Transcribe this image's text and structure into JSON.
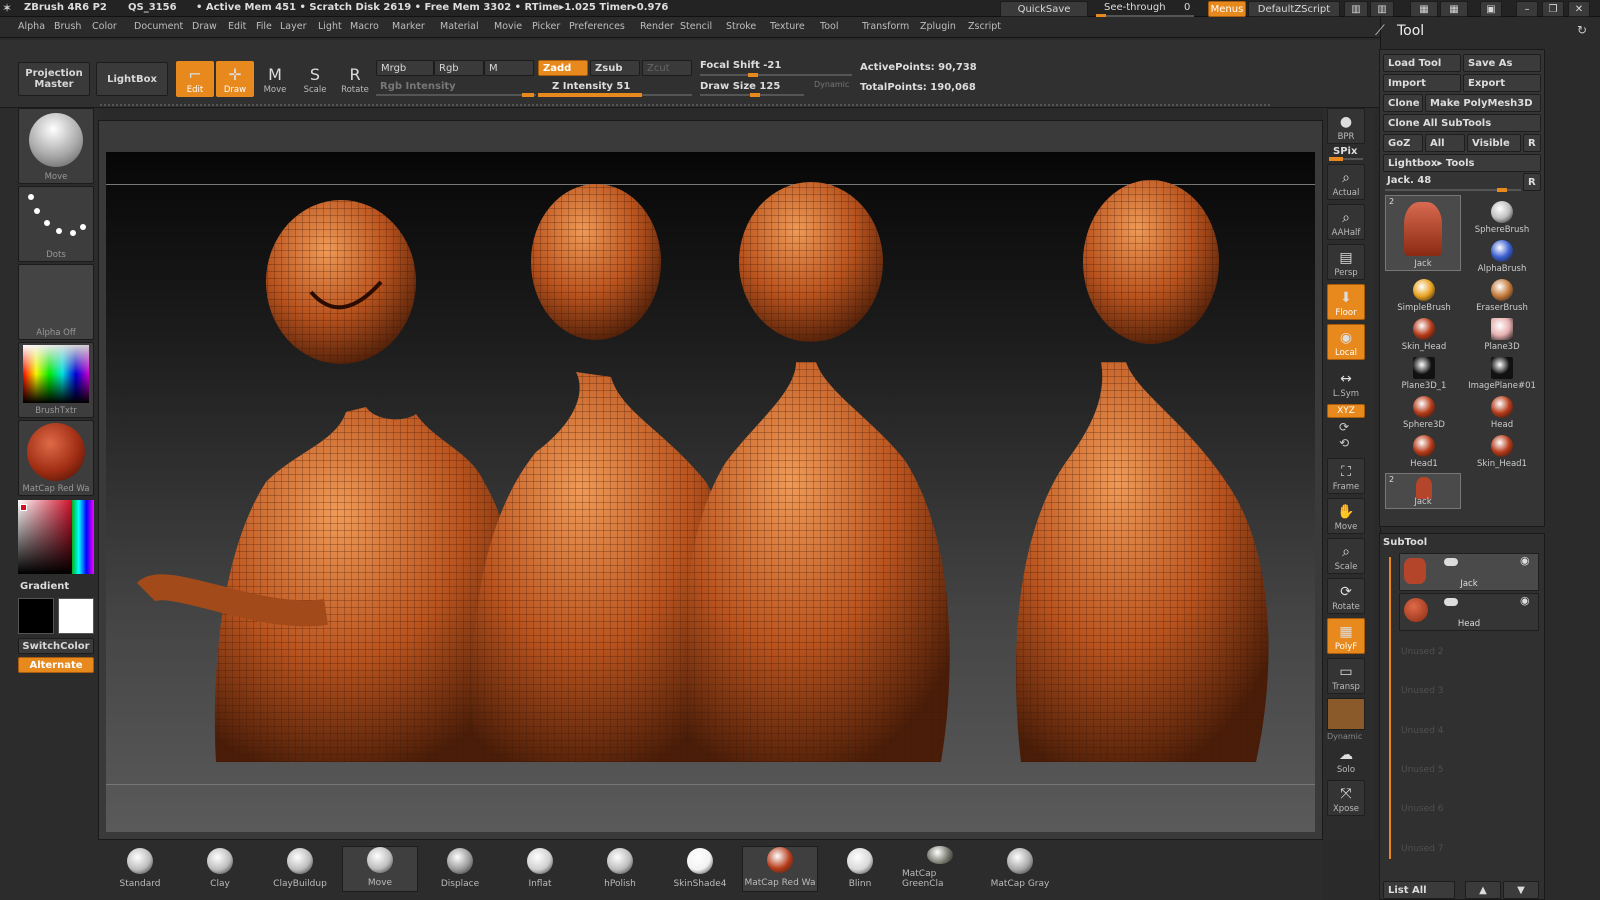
{
  "titlebar": {
    "app": "ZBrush 4R6 P2",
    "project": "QS_3156",
    "stats": "• Active Mem 451 • Scratch Disk 2619 • Free Mem 3302 • RTime▸1.025 Timer▸0.976",
    "quicksave": "QuickSave",
    "seethrough": "See-through",
    "seethrough_value": "0",
    "menus": "Menus",
    "script": "DefaultZScript"
  },
  "menubar": [
    "Alpha",
    "Brush",
    "Color",
    "Document",
    "Draw",
    "Edit",
    "File",
    "Layer",
    "Light",
    "Macro",
    "Marker",
    "Material",
    "Movie",
    "Picker",
    "Preferences",
    "Render",
    "Stencil",
    "Stroke",
    "Texture",
    "Tool",
    "Transform",
    "Zplugin",
    "Zscript"
  ],
  "topbar": {
    "projection_master": "Projection Master",
    "lightbox": "LightBox",
    "edit": "Edit",
    "draw": "Draw",
    "move": "Move",
    "scale": "Scale",
    "rotate": "Rotate",
    "mrgb": "Mrgb",
    "rgb": "Rgb",
    "m": "M",
    "rgb_intensity": "Rgb Intensity",
    "zadd": "Zadd",
    "zsub": "Zsub",
    "zcut": "Zcut",
    "z_intensity": "Z Intensity 51",
    "z_intensity_value": 51,
    "focal_shift": "Focal Shift -21",
    "draw_size": "Draw Size 125",
    "dynamic": "Dynamic",
    "active_points": "ActivePoints: 90,738",
    "total_points": "TotalPoints: 190,068"
  },
  "leftshelf": {
    "brush": "Move",
    "stroke": "Dots",
    "alpha": "Alpha Off",
    "texture": "BrushTxtr",
    "material": "MatCap Red Wa",
    "gradient": "Gradient",
    "switchcolor": "SwitchColor",
    "alternate": "Alternate"
  },
  "rightshelf": [
    "BPR",
    "SPix",
    "Actual",
    "AAHalf",
    "Persp",
    "Floor",
    "Local",
    "L.Sym",
    "XYZ",
    "Frame",
    "Move",
    "Scale",
    "Rotate",
    "PolyF",
    "Transp",
    "Dynamic",
    "Solo",
    "Xpose"
  ],
  "bottomshelf": [
    {
      "label": "Standard",
      "color": "#bdbdbd"
    },
    {
      "label": "Clay",
      "color": "#bdbdbd"
    },
    {
      "label": "ClayBuildup",
      "color": "#bdbdbd"
    },
    {
      "label": "Move",
      "color": "#bdbdbd"
    },
    {
      "label": "Displace",
      "color": "#9a9a9a"
    },
    {
      "label": "Inflat",
      "color": "#d0d0d0"
    },
    {
      "label": "hPolish",
      "color": "#bdbdbd"
    },
    {
      "label": "SkinShade4",
      "color": "#f2f2f2"
    },
    {
      "label": "MatCap Red Wa",
      "color": "#b53a18"
    },
    {
      "label": "Blinn",
      "color": "#d8d8d8"
    },
    {
      "label": "MatCap GreenCla",
      "color": "#7a7d72"
    },
    {
      "label": "MatCap Gray",
      "color": "#a8a8a8"
    }
  ],
  "toolpanel": {
    "title": "Tool",
    "load_tool": "Load Tool",
    "save_as": "Save As",
    "import": "Import",
    "export": "Export",
    "clone": "Clone",
    "make_polymesh": "Make PolyMesh3D",
    "clone_all": "Clone All SubTools",
    "goz": "GoZ",
    "all": "All",
    "visible": "Visible",
    "r": "R",
    "lightbox_tools": "Lightbox▸ Tools",
    "current_tool": "Jack. 48",
    "tools": [
      {
        "label": "SphereBrush",
        "color": "#bfbfbf"
      },
      {
        "label": "AlphaBrush",
        "color": "#3a5fd0"
      },
      {
        "label": "SimpleBrush",
        "color": "#e8a21e"
      },
      {
        "label": "EraserBrush",
        "color": "#c57a3a"
      },
      {
        "label": "Skin_Head",
        "color": "#b53a18"
      },
      {
        "label": "Plane3D",
        "color": "#e8b0b0"
      },
      {
        "label": "Plane3D_1",
        "color": "#111111"
      },
      {
        "label": "ImagePlane#01",
        "color": "#111111"
      },
      {
        "label": "Sphere3D",
        "color": "#b53a18"
      },
      {
        "label": "Head",
        "color": "#b53a18"
      },
      {
        "label": "Head1",
        "color": "#b53a18"
      },
      {
        "label": "Skin_Head1",
        "color": "#b53a18"
      }
    ],
    "jack_label": "Jack",
    "jack_count": "2",
    "jack2_label": "Jack",
    "subtool_title": "SubTool",
    "subtools": [
      "Jack",
      "Head"
    ],
    "unused": [
      "Unused 2",
      "Unused 3",
      "Unused 4",
      "Unused 5",
      "Unused 6",
      "Unused 7"
    ],
    "list_all": "List All"
  },
  "colors": {
    "accent": "#e8891e",
    "panel": "#2b2b2b",
    "model": "#c0602a"
  }
}
